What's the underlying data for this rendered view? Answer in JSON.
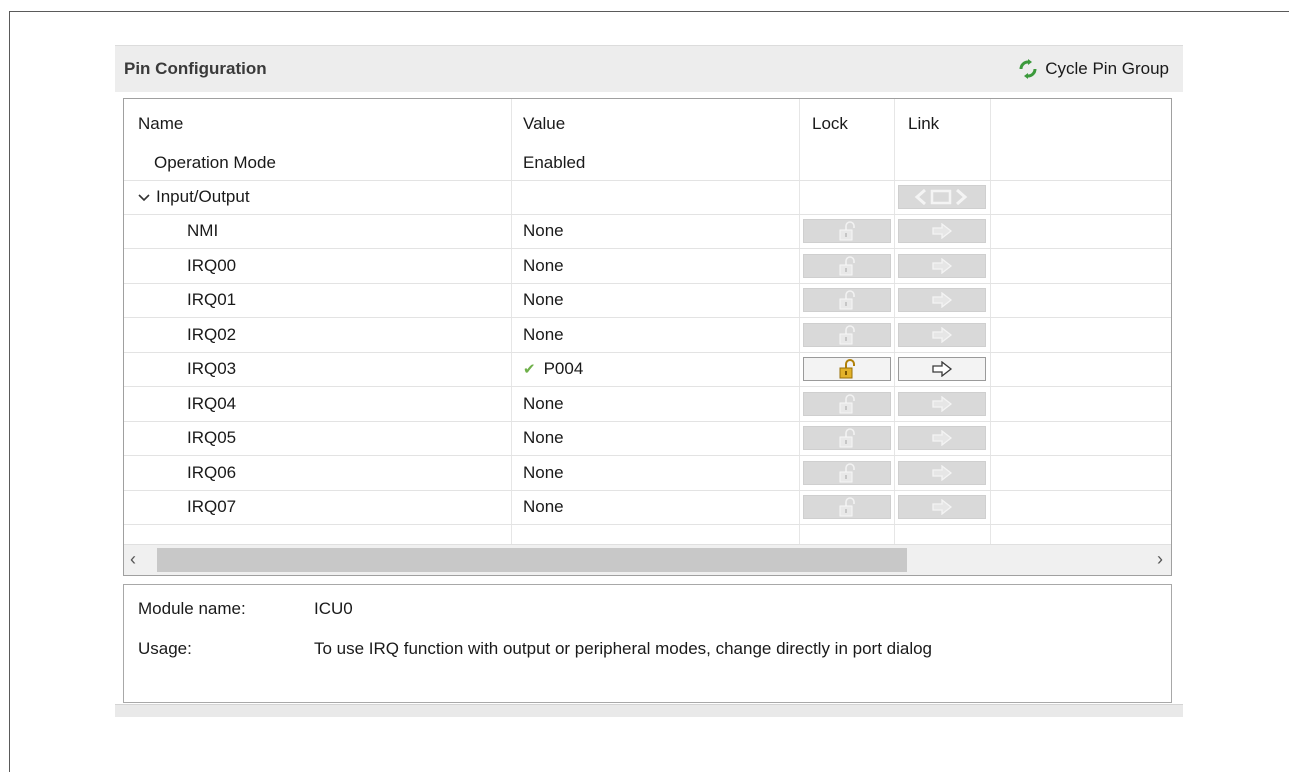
{
  "panel": {
    "title": "Pin Configuration",
    "cycle_button_label": "Cycle Pin Group",
    "cycle_icon": "cycle-arrows-icon"
  },
  "table": {
    "columns": [
      "Name",
      "Value",
      "Lock",
      "Link"
    ],
    "operation_mode": {
      "name": "Operation Mode",
      "value": "Enabled"
    },
    "group": {
      "name": "Input/Output",
      "expanded": true
    },
    "rows": [
      {
        "name": "NMI",
        "value": "None",
        "assigned": false
      },
      {
        "name": "IRQ00",
        "value": "None",
        "assigned": false
      },
      {
        "name": "IRQ01",
        "value": "None",
        "assigned": false
      },
      {
        "name": "IRQ02",
        "value": "None",
        "assigned": false
      },
      {
        "name": "IRQ03",
        "value": "P004",
        "assigned": true
      },
      {
        "name": "IRQ04",
        "value": "None",
        "assigned": false
      },
      {
        "name": "IRQ05",
        "value": "None",
        "assigned": false
      },
      {
        "name": "IRQ06",
        "value": "None",
        "assigned": false
      },
      {
        "name": "IRQ07",
        "value": "None",
        "assigned": false
      }
    ]
  },
  "info": {
    "module_label": "Module name:",
    "module_value": "ICU0",
    "usage_label": "Usage:",
    "usage_value": "To use IRQ function with output or peripheral modes, change directly in port dialog"
  },
  "colors": {
    "check_green": "#6fb04a",
    "lock_gold": "#d4a017",
    "disabled_button": "#d9d9d9"
  }
}
